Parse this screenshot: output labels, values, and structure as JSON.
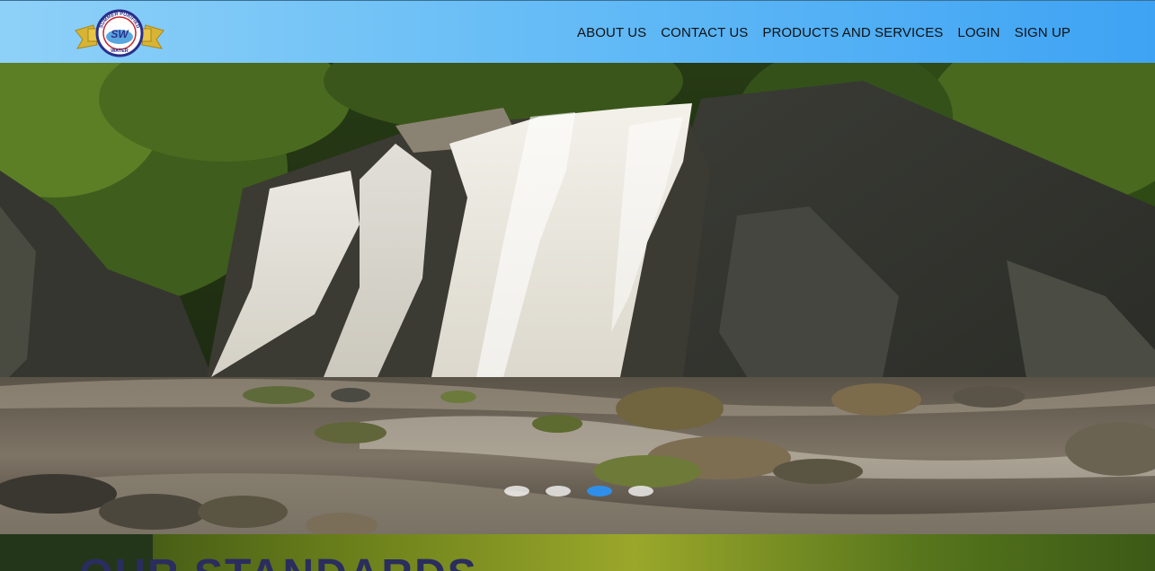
{
  "brand": {
    "logo_text_top": "SUMMER PURIFIED",
    "logo_text_center": "SW",
    "logo_text_bottom": "WATER"
  },
  "nav": {
    "items": [
      {
        "label": "ABOUT US"
      },
      {
        "label": "CONTACT US"
      },
      {
        "label": "PRODUCTS AND SERVICES"
      },
      {
        "label": "LOGIN"
      },
      {
        "label": "SIGN UP"
      }
    ]
  },
  "hero": {
    "slides": 4,
    "active_slide_index": 2,
    "image": "waterfall-photo"
  },
  "next_section": {
    "heading": "OUR STANDARDS"
  },
  "colors": {
    "header_gradient_start": "#8ed1f8",
    "header_gradient_end": "#3ea3f4",
    "active_dot": "#2f8fe8"
  }
}
